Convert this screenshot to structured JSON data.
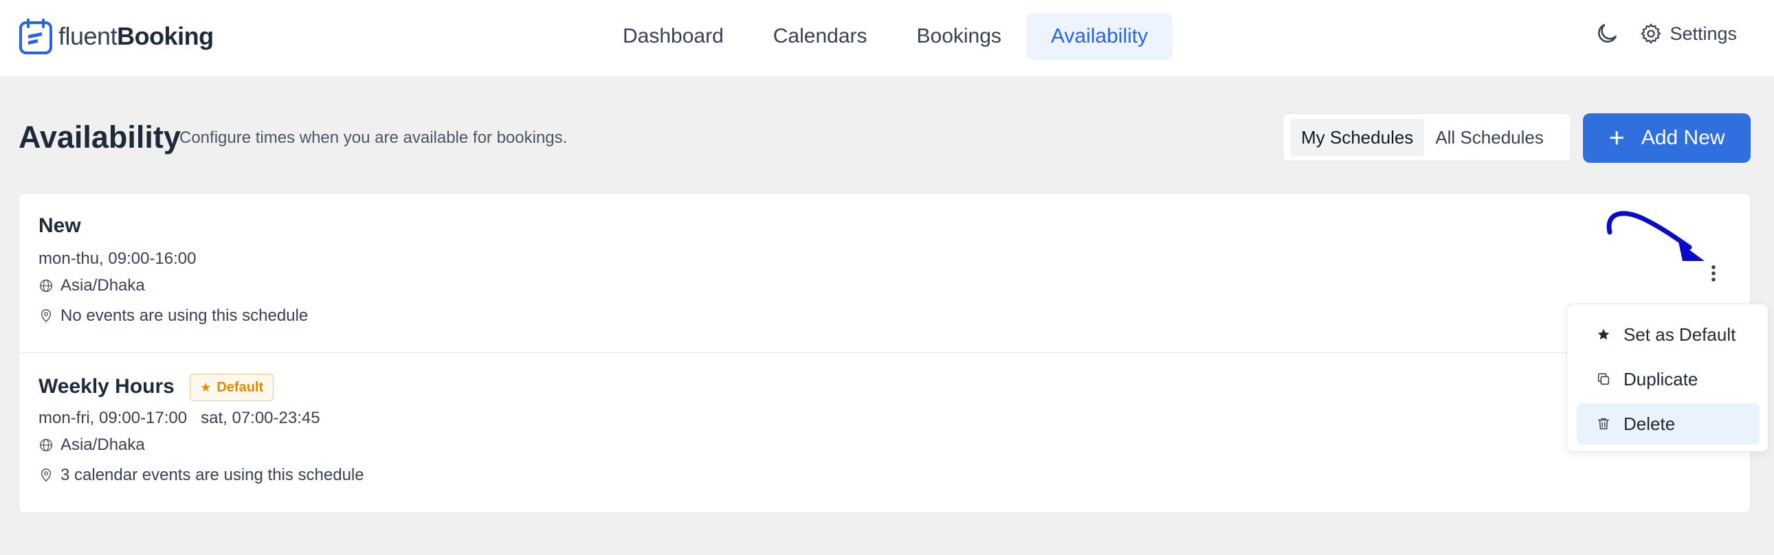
{
  "app": {
    "logo_light": "fluent",
    "logo_bold": "Booking"
  },
  "nav": {
    "items": [
      {
        "label": "Dashboard"
      },
      {
        "label": "Calendars"
      },
      {
        "label": "Bookings"
      },
      {
        "label": "Availability",
        "active": true
      }
    ]
  },
  "topright": {
    "theme_icon": "moon-icon",
    "settings_label": "Settings"
  },
  "header": {
    "title": "Availability",
    "description": "Configure times when you are available for bookings.",
    "tabs": [
      {
        "label": "My Schedules",
        "active": true
      },
      {
        "label": "All Schedules"
      }
    ],
    "add_button": "Add New"
  },
  "schedules": [
    {
      "name": "New",
      "hours": "mon-thu, 09:00-16:00",
      "timezone": "Asia/Dhaka",
      "usage": "No events are using this schedule"
    },
    {
      "name": "Weekly Hours",
      "badge": "Default",
      "hours": "mon-fri, 09:00-17:00   sat, 07:00-23:45",
      "timezone": "Asia/Dhaka",
      "usage": "3 calendar events are using this schedule"
    }
  ],
  "menu": {
    "items": [
      {
        "label": "Set as Default",
        "icon": "star-icon"
      },
      {
        "label": "Duplicate",
        "icon": "duplicate-icon"
      },
      {
        "label": "Delete",
        "icon": "trash-icon",
        "hovered": true
      }
    ]
  },
  "colors": {
    "accent": "#2f6fde",
    "badge": "#e08a00",
    "arrow": "#0a0ac8"
  }
}
